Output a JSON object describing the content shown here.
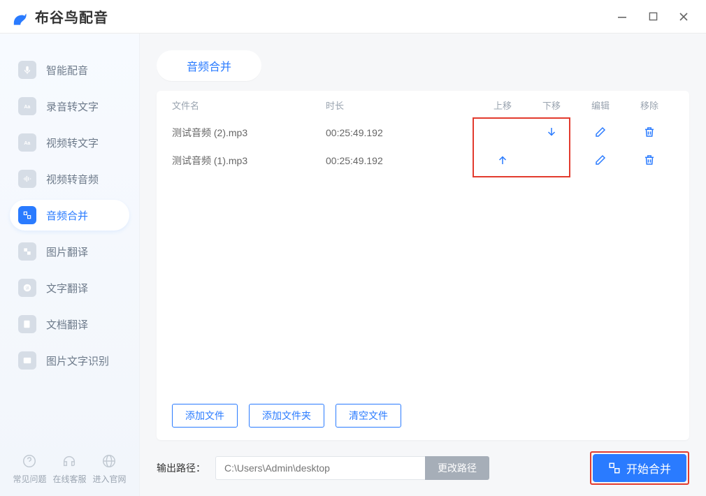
{
  "app": {
    "title": "布谷鸟配音"
  },
  "sidebar": {
    "items": [
      {
        "label": "智能配音"
      },
      {
        "label": "录音转文字"
      },
      {
        "label": "视频转文字"
      },
      {
        "label": "视频转音频"
      },
      {
        "label": "音频合并"
      },
      {
        "label": "图片翻译"
      },
      {
        "label": "文字翻译"
      },
      {
        "label": "文档翻译"
      },
      {
        "label": "图片文字识别"
      }
    ],
    "bottom": [
      {
        "label": "常见问题"
      },
      {
        "label": "在线客服"
      },
      {
        "label": "进入官网"
      }
    ]
  },
  "tab": {
    "label": "音频合并"
  },
  "table": {
    "headers": {
      "name": "文件名",
      "duration": "时长",
      "up": "上移",
      "down": "下移",
      "edit": "编辑",
      "remove": "移除"
    },
    "rows": [
      {
        "name": "测试音频 (2).mp3",
        "duration": "00:25:49.192"
      },
      {
        "name": "测试音频 (1).mp3",
        "duration": "00:25:49.192"
      }
    ]
  },
  "actions": {
    "addFile": "添加文件",
    "addFolder": "添加文件夹",
    "clear": "清空文件"
  },
  "footer": {
    "label": "输出路径：",
    "placeholder": "C:\\Users\\Admin\\desktop",
    "changePath": "更改路径",
    "start": "开始合并"
  }
}
